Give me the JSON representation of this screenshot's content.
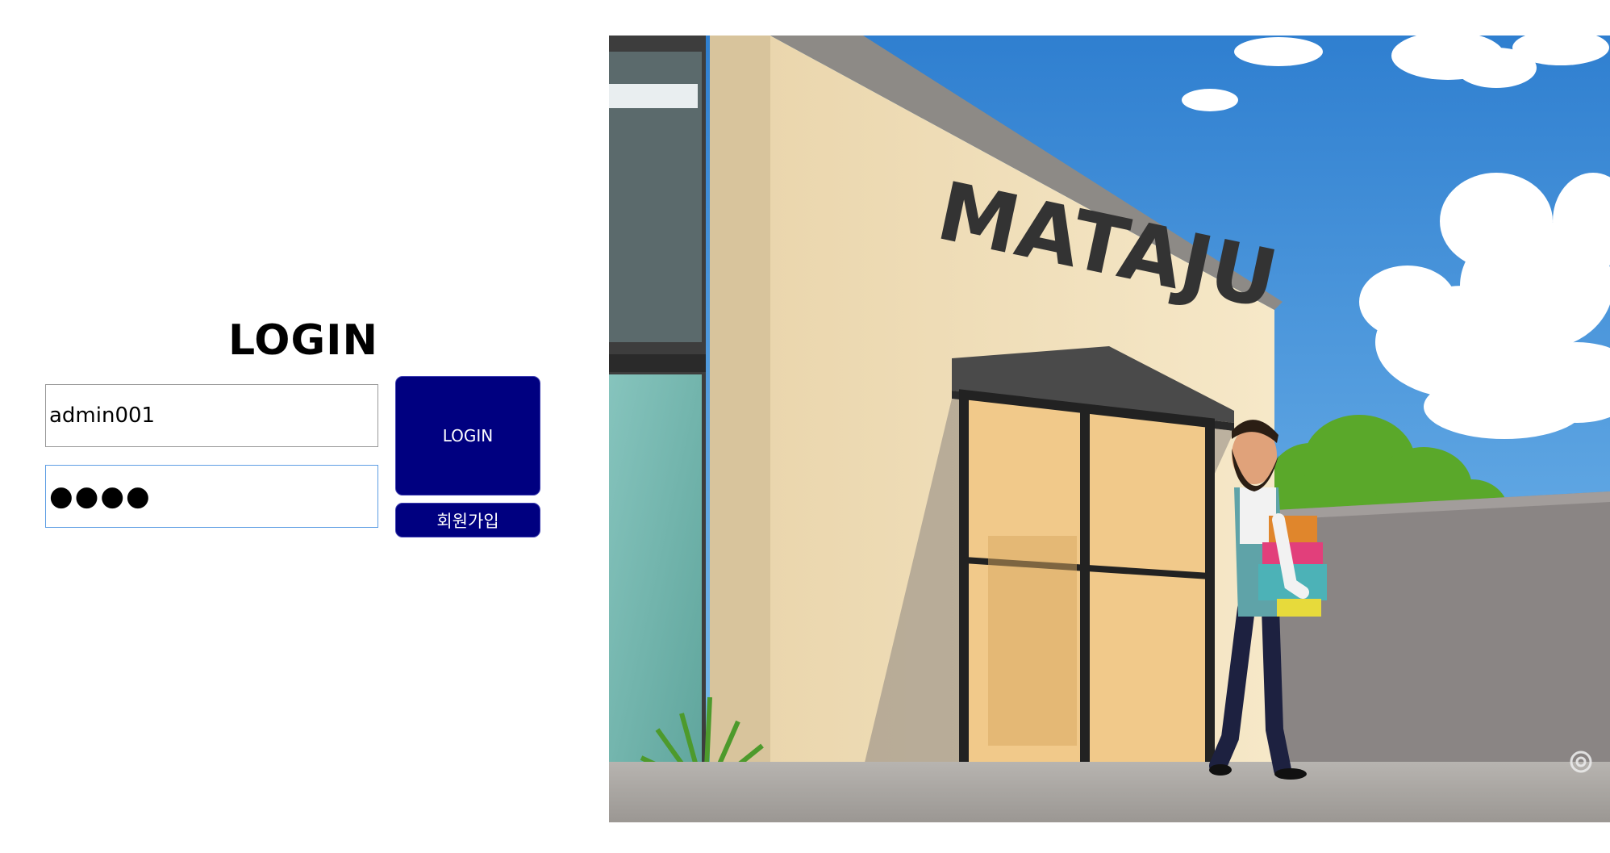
{
  "login": {
    "title": "LOGIN",
    "id_value": "admin001",
    "password_masked": "●●●●",
    "login_button_label": "LOGIN",
    "signup_button_label": "회원가입"
  },
  "hero": {
    "storefront_sign": "MATAJU",
    "colors": {
      "sky": "#3f8fd8",
      "wall": "#f4e3bf",
      "accent": "#000080"
    }
  }
}
